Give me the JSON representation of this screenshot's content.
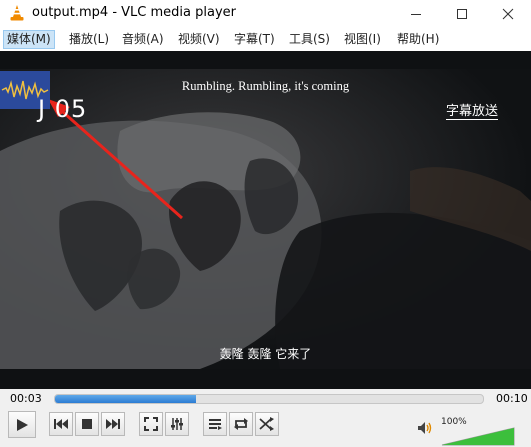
{
  "window": {
    "title": "output.mp4 - VLC media player"
  },
  "menu": [
    {
      "label": "媒体(M)",
      "active": true
    },
    {
      "label": "播放(L)"
    },
    {
      "label": "音频(A)"
    },
    {
      "label": "视频(V)"
    },
    {
      "label": "字幕(T)"
    },
    {
      "label": "工具(S)"
    },
    {
      "label": "视图(I)"
    },
    {
      "label": "帮助(H)"
    }
  ],
  "video": {
    "clock": "J 05",
    "subtitle_en": "Rumbling. Rumbling, it's coming",
    "subtitle_link": "字幕放送",
    "subtitle_cn": "轰隆 轰隆 它来了"
  },
  "playback": {
    "elapsed": "00:03",
    "total": "00:10",
    "progress": 0.33
  },
  "volume": {
    "label": "100%",
    "level": 1.0
  },
  "colors": {
    "accent": "#2b7bd3",
    "volume_green": "#3cbf3c",
    "arrow_red": "#e8241c"
  },
  "icons": [
    "vlc-cone-icon",
    "minimize-icon",
    "maximize-icon",
    "close-icon",
    "play-icon",
    "previous-icon",
    "stop-icon",
    "next-icon",
    "fullscreen-icon",
    "extended-settings-icon",
    "playlist-icon",
    "loop-icon",
    "shuffle-icon",
    "volume-icon"
  ]
}
